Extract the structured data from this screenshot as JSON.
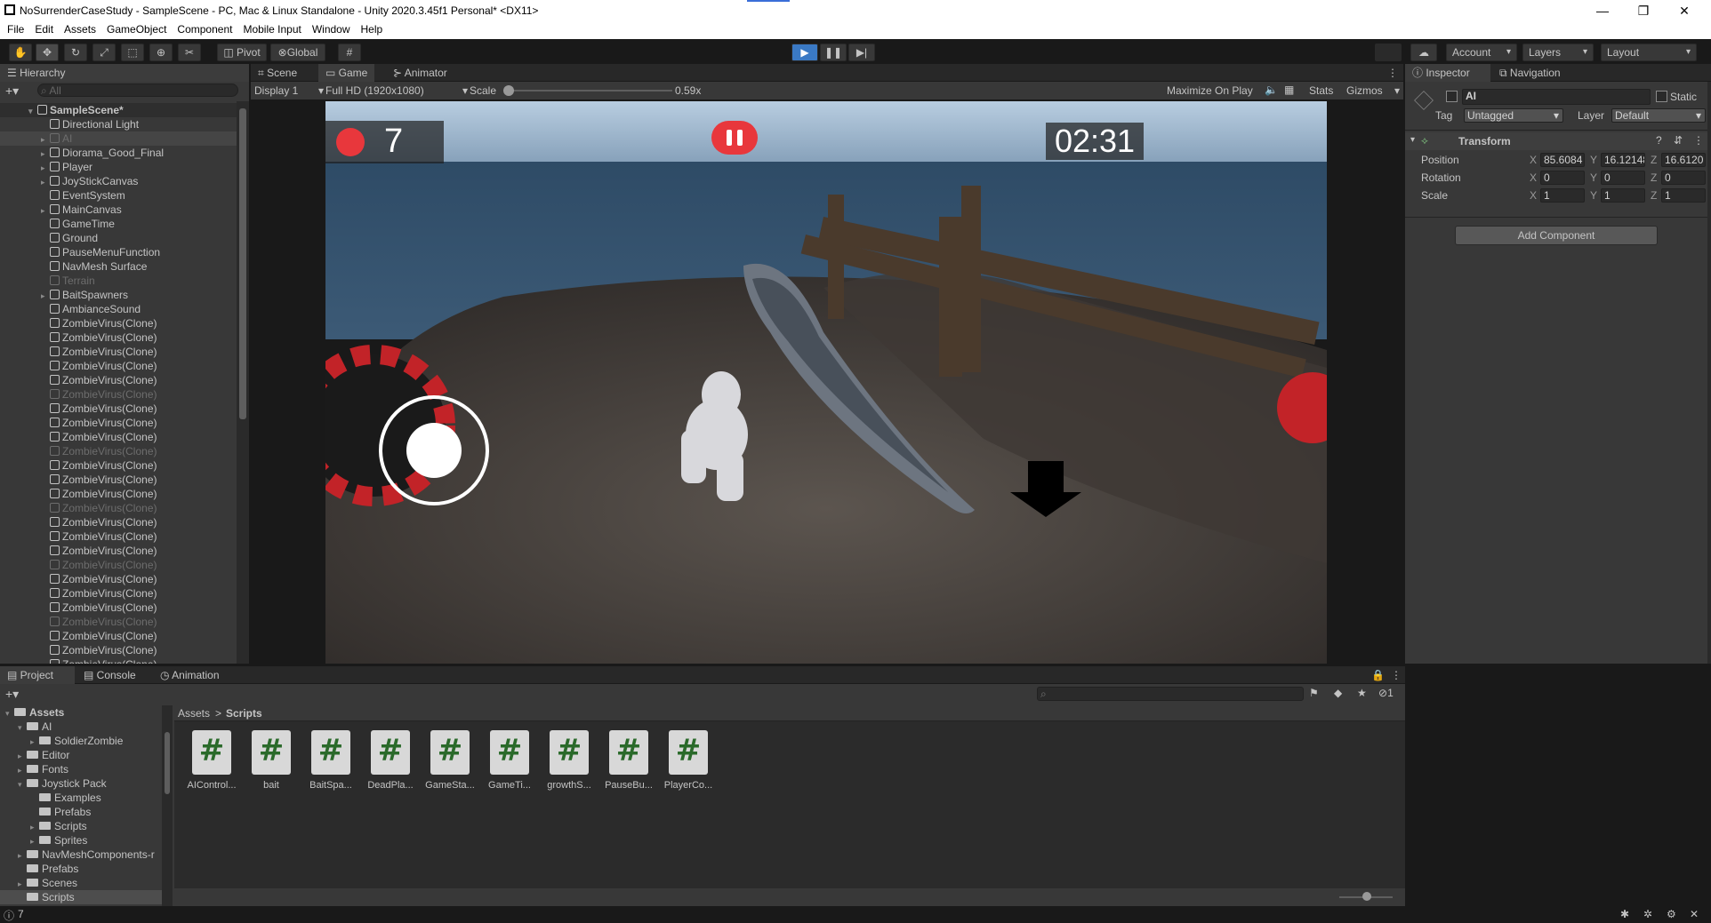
{
  "window": {
    "title": "NoSurrenderCaseStudy - SampleScene - PC, Mac & Linux Standalone - Unity 2020.3.45f1 Personal* <DX11>",
    "minimize": "—",
    "maximize": "❐",
    "close": "✕"
  },
  "menu": [
    "File",
    "Edit",
    "Assets",
    "GameObject",
    "Component",
    "Mobile Input",
    "Window",
    "Help"
  ],
  "toolbar": {
    "pivot": "Pivot",
    "global": "Global",
    "account": "Account",
    "layers": "Layers",
    "layout": "Layout"
  },
  "hierarchy": {
    "tab": "Hierarchy",
    "search_placeholder": "All",
    "scene": "SampleScene*",
    "items": [
      {
        "label": "Directional Light",
        "arrow": false,
        "dim": false,
        "sel": false
      },
      {
        "label": "AI",
        "arrow": true,
        "dim": true,
        "sel": true
      },
      {
        "label": "Diorama_Good_Final",
        "arrow": true,
        "dim": false,
        "sel": false
      },
      {
        "label": "Player",
        "arrow": true,
        "dim": false,
        "sel": false
      },
      {
        "label": "JoyStickCanvas",
        "arrow": true,
        "dim": false,
        "sel": false
      },
      {
        "label": "EventSystem",
        "arrow": false,
        "dim": false,
        "sel": false
      },
      {
        "label": "MainCanvas",
        "arrow": true,
        "dim": false,
        "sel": false
      },
      {
        "label": "GameTime",
        "arrow": false,
        "dim": false,
        "sel": false
      },
      {
        "label": "Ground",
        "arrow": false,
        "dim": false,
        "sel": false
      },
      {
        "label": "PauseMenuFunction",
        "arrow": false,
        "dim": false,
        "sel": false
      },
      {
        "label": "NavMesh Surface",
        "arrow": false,
        "dim": false,
        "sel": false
      },
      {
        "label": "Terrain",
        "arrow": false,
        "dim": true,
        "sel": false
      },
      {
        "label": "BaitSpawners",
        "arrow": true,
        "dim": false,
        "sel": false
      },
      {
        "label": "AmbianceSound",
        "arrow": false,
        "dim": false,
        "sel": false
      },
      {
        "label": "ZombieVirus(Clone)",
        "arrow": false,
        "dim": false,
        "sel": false
      },
      {
        "label": "ZombieVirus(Clone)",
        "arrow": false,
        "dim": false,
        "sel": false
      },
      {
        "label": "ZombieVirus(Clone)",
        "arrow": false,
        "dim": false,
        "sel": false
      },
      {
        "label": "ZombieVirus(Clone)",
        "arrow": false,
        "dim": false,
        "sel": false
      },
      {
        "label": "ZombieVirus(Clone)",
        "arrow": false,
        "dim": false,
        "sel": false
      },
      {
        "label": "ZombieVirus(Clone)",
        "arrow": false,
        "dim": true,
        "sel": false
      },
      {
        "label": "ZombieVirus(Clone)",
        "arrow": false,
        "dim": false,
        "sel": false
      },
      {
        "label": "ZombieVirus(Clone)",
        "arrow": false,
        "dim": false,
        "sel": false
      },
      {
        "label": "ZombieVirus(Clone)",
        "arrow": false,
        "dim": false,
        "sel": false
      },
      {
        "label": "ZombieVirus(Clone)",
        "arrow": false,
        "dim": true,
        "sel": false
      },
      {
        "label": "ZombieVirus(Clone)",
        "arrow": false,
        "dim": false,
        "sel": false
      },
      {
        "label": "ZombieVirus(Clone)",
        "arrow": false,
        "dim": false,
        "sel": false
      },
      {
        "label": "ZombieVirus(Clone)",
        "arrow": false,
        "dim": false,
        "sel": false
      },
      {
        "label": "ZombieVirus(Clone)",
        "arrow": false,
        "dim": true,
        "sel": false
      },
      {
        "label": "ZombieVirus(Clone)",
        "arrow": false,
        "dim": false,
        "sel": false
      },
      {
        "label": "ZombieVirus(Clone)",
        "arrow": false,
        "dim": false,
        "sel": false
      },
      {
        "label": "ZombieVirus(Clone)",
        "arrow": false,
        "dim": false,
        "sel": false
      },
      {
        "label": "ZombieVirus(Clone)",
        "arrow": false,
        "dim": true,
        "sel": false
      },
      {
        "label": "ZombieVirus(Clone)",
        "arrow": false,
        "dim": false,
        "sel": false
      },
      {
        "label": "ZombieVirus(Clone)",
        "arrow": false,
        "dim": false,
        "sel": false
      },
      {
        "label": "ZombieVirus(Clone)",
        "arrow": false,
        "dim": false,
        "sel": false
      },
      {
        "label": "ZombieVirus(Clone)",
        "arrow": false,
        "dim": true,
        "sel": false
      },
      {
        "label": "ZombieVirus(Clone)",
        "arrow": false,
        "dim": false,
        "sel": false
      },
      {
        "label": "ZombieVirus(Clone)",
        "arrow": false,
        "dim": false,
        "sel": false
      },
      {
        "label": "ZombieVirus(Clone)",
        "arrow": false,
        "dim": false,
        "sel": false
      }
    ]
  },
  "scene_tabs": {
    "scene": "Scene",
    "game": "Game",
    "animator": "Animator"
  },
  "game_toolbar": {
    "display": "Display 1",
    "resolution": "Full HD (1920x1080)",
    "scale_label": "Scale",
    "scale_value": "0.59x",
    "maximize": "Maximize On Play",
    "stats": "Stats",
    "gizmos": "Gizmos"
  },
  "game_hud": {
    "score": "7",
    "timer": "02:31"
  },
  "inspector": {
    "tab_inspector": "Inspector",
    "tab_navigation": "Navigation",
    "object_name": "AI",
    "static_label": "Static",
    "tag_label": "Tag",
    "tag_value": "Untagged",
    "layer_label": "Layer",
    "layer_value": "Default",
    "component": "Transform",
    "position_label": "Position",
    "rotation_label": "Rotation",
    "scale_label": "Scale",
    "position": {
      "x": "85.6084",
      "y": "16.12148",
      "z": "16.6120"
    },
    "rotation": {
      "x": "0",
      "y": "0",
      "z": "0"
    },
    "scale": {
      "x": "1",
      "y": "1",
      "z": "1"
    },
    "add_component": "Add Component"
  },
  "project": {
    "tab_project": "Project",
    "tab_console": "Console",
    "tab_animation": "Animation",
    "hidden_count": "1",
    "breadcrumb_root": "Assets",
    "breadcrumb_sep": ">",
    "breadcrumb_current": "Scripts",
    "tree": [
      {
        "label": "Assets",
        "depth": 0,
        "arrow": "▾",
        "bold": true
      },
      {
        "label": "AI",
        "depth": 1,
        "arrow": "▾",
        "bold": false
      },
      {
        "label": "SoldierZombie",
        "depth": 2,
        "arrow": "▸",
        "bold": false
      },
      {
        "label": "Editor",
        "depth": 1,
        "arrow": "▸",
        "bold": false
      },
      {
        "label": "Fonts",
        "depth": 1,
        "arrow": "▸",
        "bold": false
      },
      {
        "label": "Joystick Pack",
        "depth": 1,
        "arrow": "▾",
        "bold": false
      },
      {
        "label": "Examples",
        "depth": 2,
        "arrow": "",
        "bold": false
      },
      {
        "label": "Prefabs",
        "depth": 2,
        "arrow": "",
        "bold": false
      },
      {
        "label": "Scripts",
        "depth": 2,
        "arrow": "▸",
        "bold": false
      },
      {
        "label": "Sprites",
        "depth": 2,
        "arrow": "▸",
        "bold": false
      },
      {
        "label": "NavMeshComponents-r",
        "depth": 1,
        "arrow": "▸",
        "bold": false
      },
      {
        "label": "Prefabs",
        "depth": 1,
        "arrow": "",
        "bold": false
      },
      {
        "label": "Scenes",
        "depth": 1,
        "arrow": "▸",
        "bold": false
      },
      {
        "label": "Scripts",
        "depth": 1,
        "arrow": "",
        "bold": false
      }
    ],
    "assets": [
      "AIControl...",
      "bait",
      "BaitSpa...",
      "DeadPla...",
      "GameSta...",
      "GameTi...",
      "growthS...",
      "PauseBu...",
      "PlayerCo..."
    ]
  },
  "status": {
    "count": "7"
  },
  "colors": {
    "hud_red": "#e8373c",
    "play_blue": "#3a79c4"
  }
}
